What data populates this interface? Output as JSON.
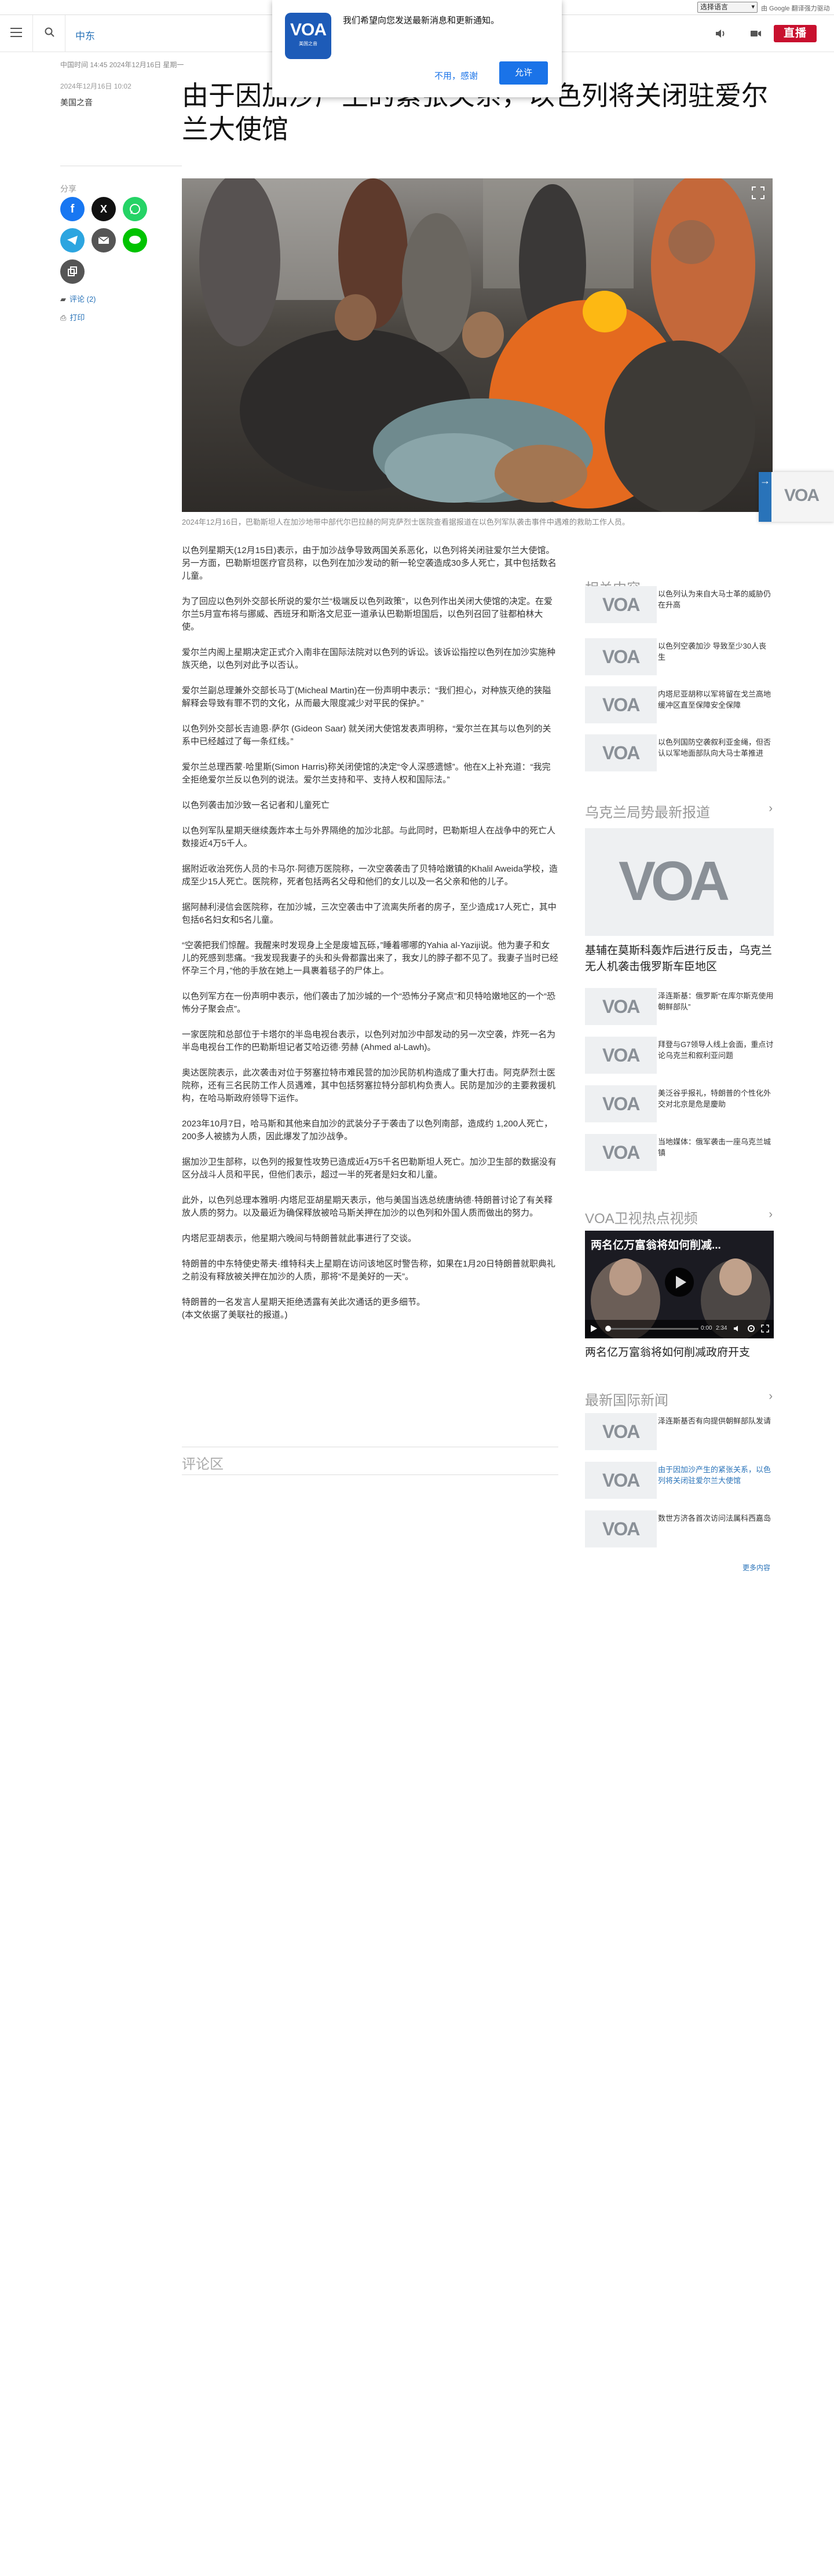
{
  "translate_bar": {
    "select_label": "选择语言",
    "powered_by": "由 Google 翻译强力驱动",
    "powered_by_brand": "翻译"
  },
  "header": {
    "section": "中东",
    "live_label": "直播"
  },
  "dialog": {
    "logo_text": "VOA",
    "logo_sub": "美国之音",
    "message": "我们希望向您发送最新消息和更新通知。",
    "later": "不用，感谢",
    "allow": "允许"
  },
  "article": {
    "date_line": "中国时间 14:45 2024年12月16日 星期一",
    "date_updated": "2024年12月16日 10:02",
    "author": "美国之音",
    "title": "由于因加沙产生的紧张关系，以色列将关闭驻爱尔兰大使馆",
    "share_label": "分享",
    "comments_link": "评论 (2)",
    "print_link": "打印",
    "caption": "2024年12月16日，巴勒斯坦人在加沙地带中部代尔巴拉赫的阿克萨烈士医院查看据报道在以色列军队袭击事件中遇难的救助工作人员。",
    "paragraphs": [
      "以色列星期天(12月15日)表示，由于加沙战争导致两国关系恶化，以色列将关闭驻爱尔兰大使馆。另一方面，巴勒斯坦医疗官员称，以色列在加沙发动的新一轮空袭造成30多人死亡，其中包括数名儿童。",
      "为了回应以色列外交部长所说的爱尔兰“极端反以色列政策”，以色列作出关闭大使馆的决定。在爱尔兰5月宣布将与挪威、西班牙和斯洛文尼亚一道承认巴勒斯坦国后，以色列召回了驻都柏林大使。",
      "爱尔兰内阁上星期决定正式介入南非在国际法院对以色列的诉讼。该诉讼指控以色列在加沙实施种族灭绝，以色列对此予以否认。",
      "爱尔兰副总理兼外交部长马丁(Micheal Martin)在一份声明中表示：“我们担心，对种族灭绝的狭隘解释会导致有罪不罚的文化，从而最大限度减少对平民的保护。”",
      "以色列外交部长吉迪恩·萨尔 (Gideon Saar) 就关闭大使馆发表声明称，“爱尔兰在其与以色列的关系中已经越过了每一条红线。”",
      "爱尔兰总理西蒙·哈里斯(Simon Harris)称关闭使馆的决定“令人深感遗憾”。他在X上补充道：“我完全拒绝爱尔兰反以色列的说法。爱尔兰支持和平、支持人权和国际法。”",
      "以色列袭击加沙致一名记者和儿童死亡",
      "以色列军队星期天继续轰炸本土与外界隔绝的加沙北部。与此同时，巴勒斯坦人在战争中的死亡人数接近4万5千人。",
      "据附近收治死伤人员的卡马尔·阿德万医院称，一次空袭袭击了贝特哈嫩镇的Khalil Aweida学校，造成至少15人死亡。医院称，死者包括两名父母和他们的女儿以及一名父亲和他的儿子。",
      "据阿赫利浸信会医院称，在加沙城，三次空袭击中了流离失所者的房子，至少造成17人死亡，其中包括6名妇女和5名儿童。",
      "“空袭把我们惊醒。我醒来时发现身上全是废墟瓦砾，”睡着哪哪的Yahia al-Yaziji说。他为妻子和女儿的死感到悲痛。“我发现我妻子的头和头骨都露出来了，我女儿的脖子都不见了。我妻子当时已经怀孕三个月，”他的手放在她上一具裹着毯子的尸体上。",
      "以色列军方在一份声明中表示，他们袭击了加沙城的一个“恐怖分子窝点”和贝特哈嫩地区的一个“恐怖分子聚会点”。",
      "一家医院和总部位于卡塔尔的半岛电视台表示，以色列对加沙中部发动的另一次空袭，炸死一名为半岛电视台工作的巴勒斯坦记者艾哈迈德·劳赫 (Ahmed al-Lawh)。",
      "奥达医院表示，此次袭击对位于努塞拉特市难民营的加沙民防机构造成了重大打击。阿克萨烈士医院称，还有三名民防工作人员遇难，其中包括努塞拉特分部机构负责人。民防是加沙的主要救援机构，在哈马斯政府领导下运作。",
      "2023年10月7日，哈马斯和其他来自加沙的武装分子于袭击了以色列南部，造成约 1,200人死亡，200多人被掳为人质，因此爆发了加沙战争。",
      "据加沙卫生部称，以色列的报复性攻势已造成近4万5千名巴勒斯坦人死亡。加沙卫生部的数据没有区分战斗人员和平民，但他们表示，超过一半的死者是妇女和儿童。",
      "此外，以色列总理本雅明·内塔尼亚胡星期天表示，他与美国当选总统唐纳德·特朗普讨论了有关释放人质的努力。以及最近为确保释放被哈马斯关押在加沙的以色列和外国人质而做出的努力。",
      "内塔尼亚胡表示，他星期六晚间与特朗普就此事进行了交谈。",
      "特朗普的中东特使史蒂夫·维特科夫上星期在访问该地区时警告称，如果在1月20日特朗普就职典礼之前没有释放被关押在加沙的人质，那将“不是美好的一天”。",
      "特朗普的一名发言人星期天拒绝透露有关此次通话的更多细节。\n(本文依据了美联社的报道。)"
    ],
    "comments_heading": "评论区"
  },
  "sidebar": {
    "related_heading": "相关内容",
    "related": [
      "以色列认为来自大马士革的威胁仍在升高",
      "以色列空袭加沙 导致至少30人丧生",
      "内塔尼亚胡称以军将留在戈兰高地缓冲区直至保障安全保障",
      "以色列国防空袭叙利亚金绳，但否认以军地面部队向大马士革推进"
    ],
    "ukraine_heading": "乌克兰局势最新报道",
    "ukraine_feature": "基辅在莫斯科轰炸后进行反击，乌克兰无人机袭击俄罗斯车臣地区",
    "ukraine_items": [
      "泽连斯基：俄罗斯“在库尔斯克使用朝鲜部队”",
      "拜登与G7领导人线上会面，重点讨论乌克兰和叙利亚问题",
      "美泛谷乎报礼，特朗普的个性化外交对北京是危是慶助",
      "当地媒体：俄军袭击一座乌克兰城镇"
    ],
    "video_heading": "VOA卫视热点视频",
    "video_title": "两名亿万富翁将如何削减...",
    "video_caption": "两名亿万富翁将如何削减政府开支",
    "video_time_current": "0:00",
    "video_time_total": "2:34",
    "intl_heading": "最新国际新闻",
    "intl_items": [
      "泽连斯基否有向提供朝鲜部队发请",
      "由于因加沙产生的紧张关系，以色列将关闭驻爱尔兰大使馆",
      "数世方济各首次访问法属科西嘉岛"
    ],
    "more_link": "更多内容",
    "voa_mark": "VOA"
  }
}
